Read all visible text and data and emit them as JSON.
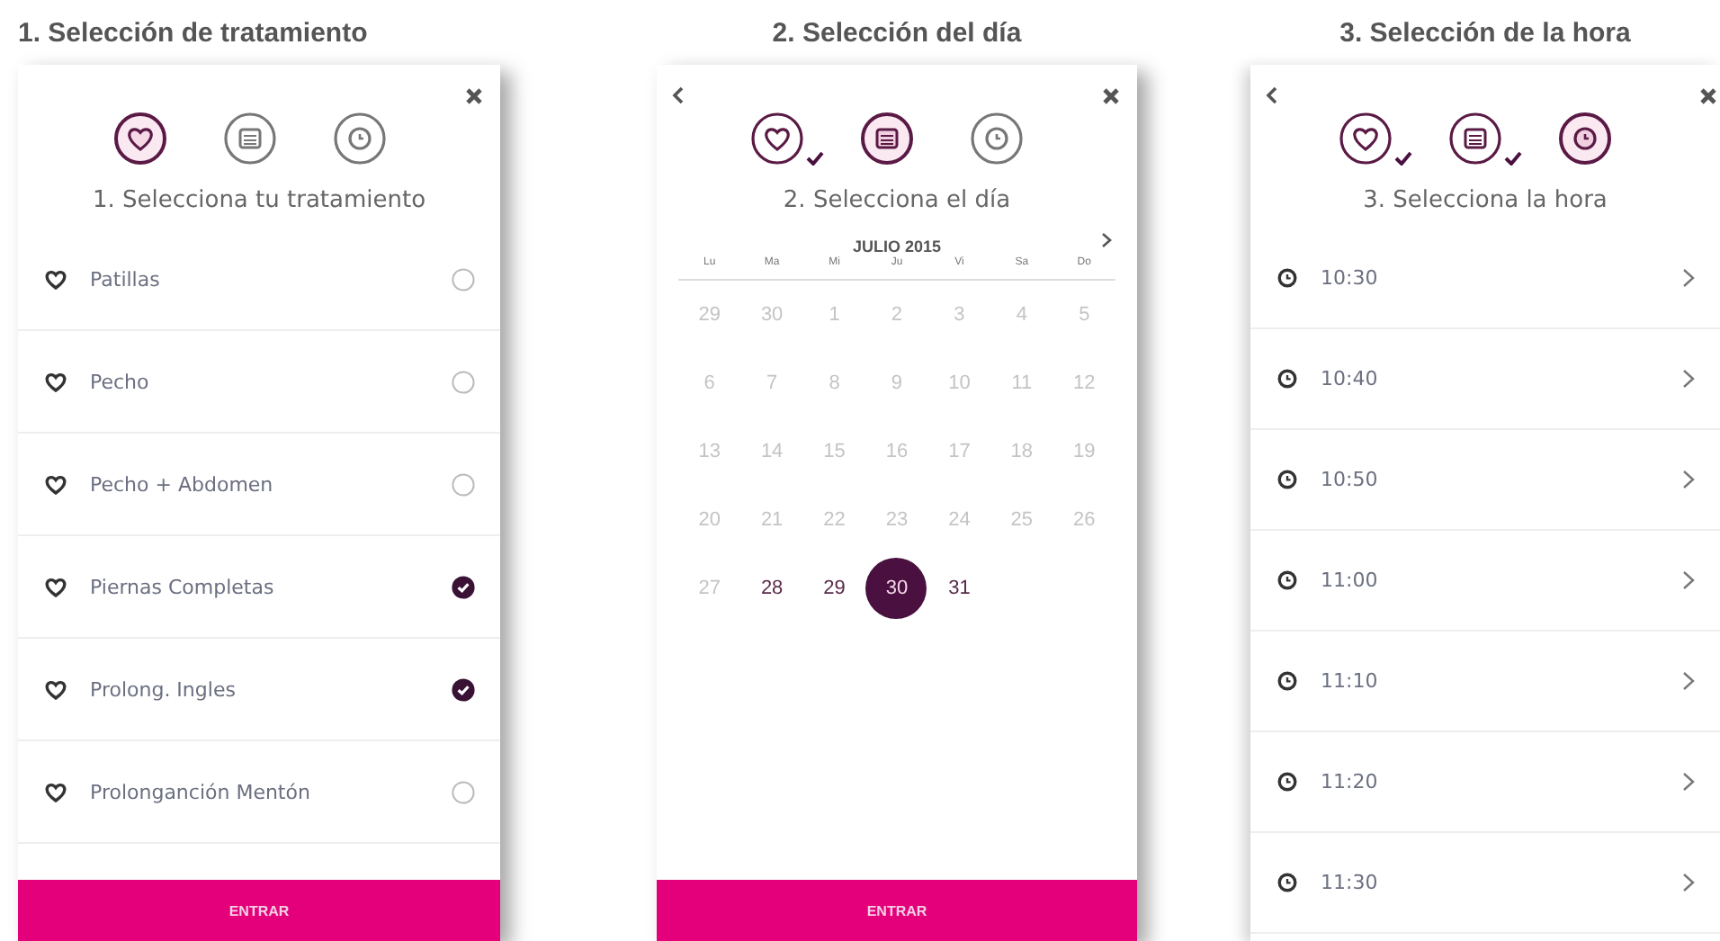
{
  "panels": [
    {
      "heading": "1. Selección de tratamiento",
      "back": false,
      "steps": [
        {
          "kind": "heart",
          "active": true,
          "done": false
        },
        {
          "kind": "calendar",
          "active": false,
          "done": false
        },
        {
          "kind": "clock",
          "active": false,
          "done": false
        }
      ],
      "subtitle": "1. Selecciona tu tratamiento",
      "kind": "treatments",
      "items": [
        {
          "label": "Patillas",
          "selected": false
        },
        {
          "label": "Pecho",
          "selected": false
        },
        {
          "label": "Pecho + Abdomen",
          "selected": false
        },
        {
          "label": "Piernas Completas",
          "selected": true
        },
        {
          "label": "Prolong. Ingles",
          "selected": true
        },
        {
          "label": "Prolonganción Mentón",
          "selected": false
        }
      ],
      "button": "ENTRAR"
    },
    {
      "heading": "2. Selección del día",
      "back": true,
      "steps": [
        {
          "kind": "heart",
          "active": false,
          "done": true
        },
        {
          "kind": "calendar",
          "active": true,
          "done": false
        },
        {
          "kind": "clock",
          "active": false,
          "done": false
        }
      ],
      "subtitle": "2. Selecciona el día",
      "kind": "calendar",
      "month": "JULIO 2015",
      "weekdays": [
        "Lu",
        "Ma",
        "Mi",
        "Ju",
        "Vi",
        "Sa",
        "Do"
      ],
      "weeks": [
        [
          {
            "label": "29",
            "disabled": true,
            "selected": false
          },
          {
            "label": "30",
            "disabled": true,
            "selected": false
          },
          {
            "label": "1",
            "disabled": true,
            "selected": false
          },
          {
            "label": "2",
            "disabled": true,
            "selected": false
          },
          {
            "label": "3",
            "disabled": true,
            "selected": false
          },
          {
            "label": "4",
            "disabled": true,
            "selected": false
          },
          {
            "label": "5",
            "disabled": true,
            "selected": false
          }
        ],
        [
          {
            "label": "6",
            "disabled": true,
            "selected": false
          },
          {
            "label": "7",
            "disabled": true,
            "selected": false
          },
          {
            "label": "8",
            "disabled": true,
            "selected": false
          },
          {
            "label": "9",
            "disabled": true,
            "selected": false
          },
          {
            "label": "10",
            "disabled": true,
            "selected": false
          },
          {
            "label": "11",
            "disabled": true,
            "selected": false
          },
          {
            "label": "12",
            "disabled": true,
            "selected": false
          }
        ],
        [
          {
            "label": "13",
            "disabled": true,
            "selected": false
          },
          {
            "label": "14",
            "disabled": true,
            "selected": false
          },
          {
            "label": "15",
            "disabled": true,
            "selected": false
          },
          {
            "label": "16",
            "disabled": true,
            "selected": false
          },
          {
            "label": "17",
            "disabled": true,
            "selected": false
          },
          {
            "label": "18",
            "disabled": true,
            "selected": false
          },
          {
            "label": "19",
            "disabled": true,
            "selected": false
          }
        ],
        [
          {
            "label": "20",
            "disabled": true,
            "selected": false
          },
          {
            "label": "21",
            "disabled": true,
            "selected": false
          },
          {
            "label": "22",
            "disabled": true,
            "selected": false
          },
          {
            "label": "23",
            "disabled": true,
            "selected": false
          },
          {
            "label": "24",
            "disabled": true,
            "selected": false
          },
          {
            "label": "25",
            "disabled": true,
            "selected": false
          },
          {
            "label": "26",
            "disabled": true,
            "selected": false
          }
        ],
        [
          {
            "label": "27",
            "disabled": true,
            "selected": false
          },
          {
            "label": "28",
            "disabled": false,
            "selected": false
          },
          {
            "label": "29",
            "disabled": false,
            "selected": false
          },
          {
            "label": "30",
            "disabled": false,
            "selected": true
          },
          {
            "label": "31",
            "disabled": false,
            "selected": false
          }
        ]
      ],
      "button": "ENTRAR"
    },
    {
      "heading": "3. Selección de la hora",
      "back": true,
      "steps": [
        {
          "kind": "heart",
          "active": false,
          "done": true
        },
        {
          "kind": "calendar",
          "active": false,
          "done": true
        },
        {
          "kind": "clock",
          "active": true,
          "done": false
        }
      ],
      "subtitle": "3. Selecciona la hora",
      "kind": "times",
      "items": [
        {
          "label": "10:30"
        },
        {
          "label": "10:40"
        },
        {
          "label": "10:50"
        },
        {
          "label": "11:00"
        },
        {
          "label": "11:10"
        },
        {
          "label": "11:20"
        },
        {
          "label": "11:30"
        }
      ]
    }
  ]
}
